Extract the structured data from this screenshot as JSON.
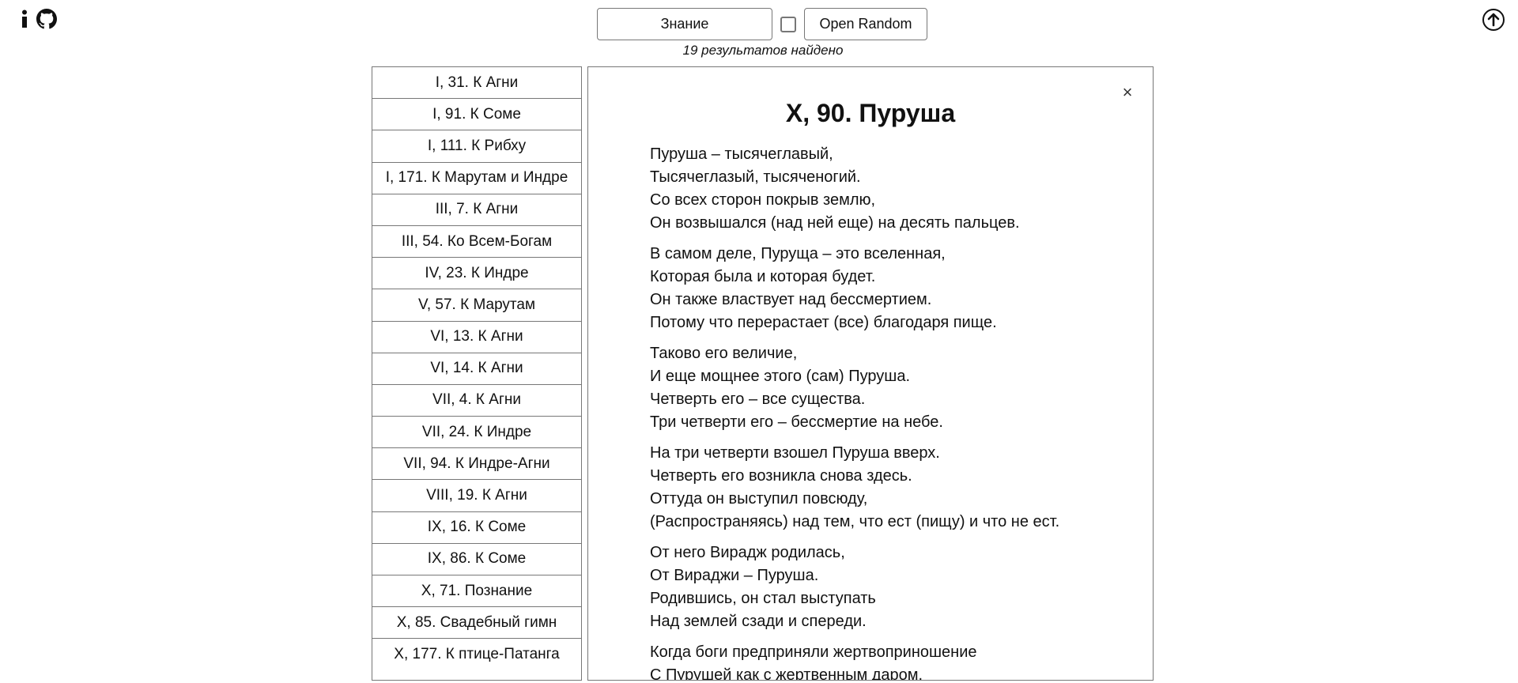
{
  "header": {
    "search_value": "Знание",
    "random_label": "Open Random",
    "results_text": "19 результатов найдено"
  },
  "icons": {
    "info": "info-icon",
    "github": "github-icon",
    "upload": "arrow-up-circle-icon"
  },
  "hymn_list": [
    "I, 31. К Агни",
    "I, 91. К Соме",
    "I, 111. К Рибху",
    "I, 171. К Марутам и Индре",
    "III, 7. К Агни",
    "III, 54. Ко Всем-Богам",
    "IV, 23. К Индре",
    "V, 57. К Марутам",
    "VI, 13. К Агни",
    "VI, 14. К Агни",
    "VII, 4. К Агни",
    "VII, 24. К Индре",
    "VII, 94. К Индре-Агни",
    "VIII, 19. К Агни",
    "IX, 16. К Соме",
    "IX, 86. К Соме",
    "X, 71. Познание",
    "X, 85. Свадебный гимн",
    "X, 177. К птице-Патанга"
  ],
  "reader": {
    "close_symbol": "×",
    "title": "X, 90. Пуруша",
    "stanzas": [
      [
        "Пуруша – тысячеглавый,",
        "Тысячеглазый, тысяченогий.",
        "Со всех сторон покрыв землю,",
        "Он возвышался (над ней еще) на десять пальцев."
      ],
      [
        "В самом деле, Пурущa – это вселенная,",
        "Которая была и которая будет.",
        "Он также властвует над бессмертием.",
        "Потому что перерастает (все) благодаря пище."
      ],
      [
        "Таково его величие,",
        "И еще мощнее этого (сам) Пуруша.",
        "Четверть его – все существа.",
        "Три четверти его – бессмертие на небе."
      ],
      [
        "На три четверти взошел Пуруша вверх.",
        "Четверть его возникла снова здесь.",
        "Оттуда он выступил повсюду,",
        "(Распространяясь) над тем, что ест (пищу) и что не ест."
      ],
      [
        "От него Вирадж родилась,",
        "От Вираджи – Пуруша.",
        "Родившись, он стал выступать",
        "Над землей сзади и спереди."
      ],
      [
        "Когда боги предприняли жертвоприношение",
        "С Пурушей как с жертвенным даром."
      ]
    ]
  }
}
